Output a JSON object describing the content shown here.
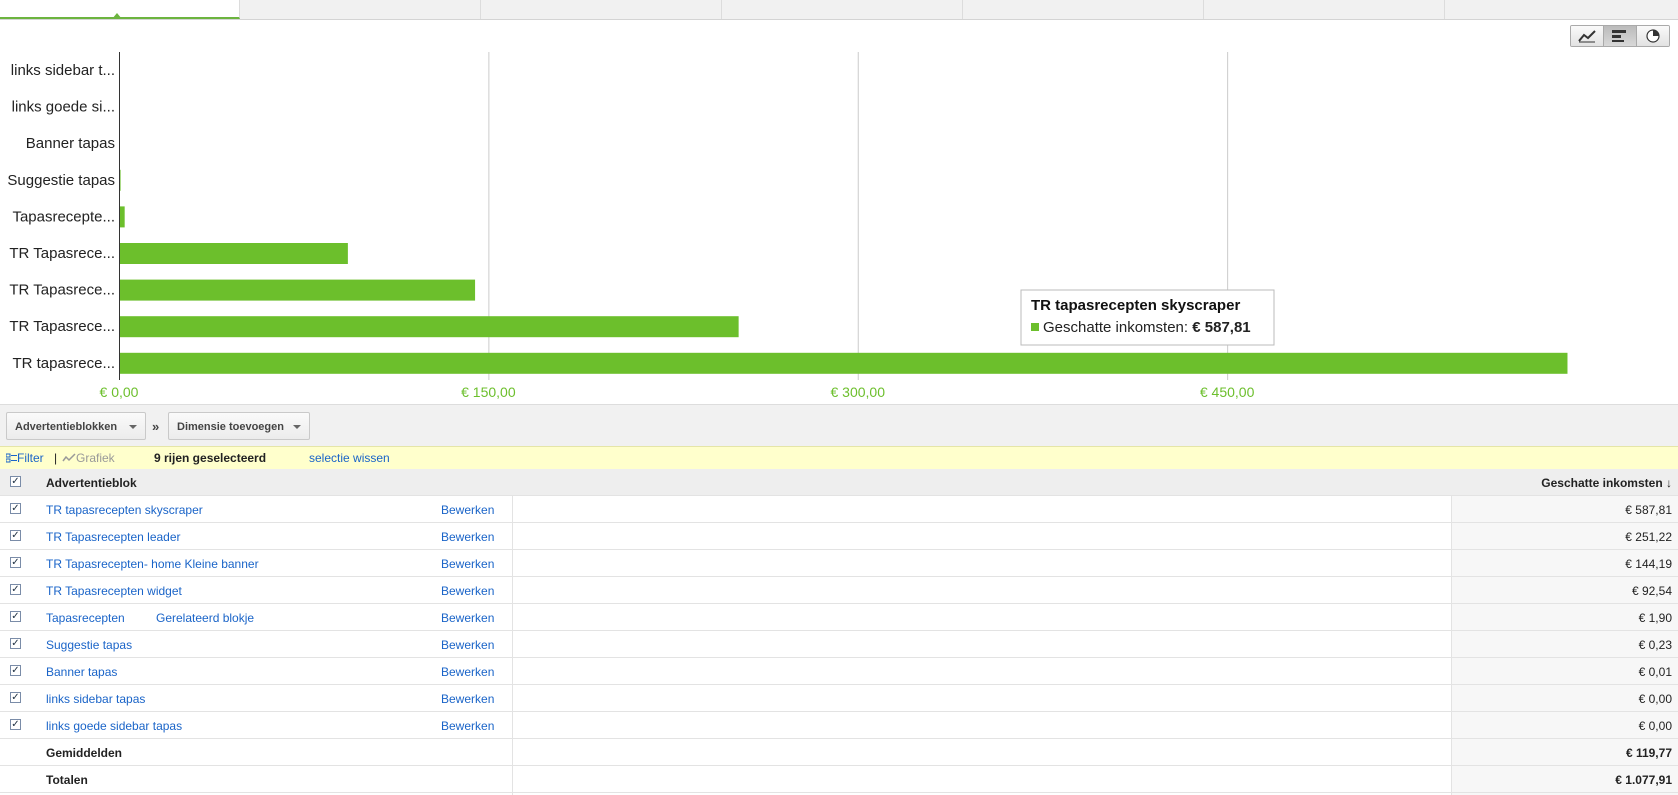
{
  "chart_data": {
    "type": "bar",
    "orientation": "horizontal",
    "categories": [
      "links sidebar t...",
      "links goede si...",
      "Banner tapas",
      "Suggestie tapas",
      "Tapasrecepte...",
      "TR Tapasrece...",
      "TR Tapasrece...",
      "TR Tapasrece...",
      "TR tapasrece..."
    ],
    "values": [
      0.0,
      0.0,
      0.01,
      0.23,
      1.9,
      92.54,
      144.19,
      251.22,
      587.81
    ],
    "xlim": [
      0,
      600
    ],
    "xticks": [
      "€ 0,00",
      "€ 150,00",
      "€ 300,00",
      "€ 450,00"
    ],
    "xtick_values": [
      0,
      150,
      300,
      450
    ],
    "bar_color": "#6cbf2c",
    "grid": true,
    "tooltip": {
      "title": "TR tapasrecepten skyscraper",
      "label": "Geschatte inkomsten:",
      "value": "€ 587,81"
    }
  },
  "toolbar": {
    "primary_dimension": "Advertentieblokken",
    "separator": "»",
    "add_dimension": "Dimensie toevoegen"
  },
  "selection": {
    "filter": "Filter",
    "divider": "|",
    "graph": "Grafiek",
    "count": "9 rijen geselecteerd",
    "clear": "selectie wissen"
  },
  "table": {
    "col_name": "Advertentieblok",
    "col_value": "Geschatte inkomsten ↓",
    "edit_label": "Bewerken",
    "rows": [
      {
        "name": "TR tapasrecepten skyscraper",
        "extra": "",
        "value": "€ 587,81"
      },
      {
        "name": "TR Tapasrecepten leader",
        "extra": "",
        "value": "€ 251,22"
      },
      {
        "name": "TR Tapasrecepten- home Kleine banner",
        "extra": "",
        "value": "€ 144,19"
      },
      {
        "name": "TR Tapasrecepten widget",
        "extra": "",
        "value": "€ 92,54"
      },
      {
        "name": "Tapasrecepten",
        "extra": "Gerelateerd blokje",
        "value": "€ 1,90"
      },
      {
        "name": "Suggestie tapas",
        "extra": "",
        "value": "€ 0,23"
      },
      {
        "name": "Banner tapas",
        "extra": "",
        "value": "€ 0,01"
      },
      {
        "name": "links sidebar tapas",
        "extra": "",
        "value": "€ 0,00"
      },
      {
        "name": "links goede sidebar tapas",
        "extra": "",
        "value": "€ 0,00"
      }
    ],
    "avg_label": "Gemiddelden",
    "avg_value": "€ 119,77",
    "total_label": "Totalen",
    "total_value": "€ 1.077,91"
  },
  "icons": {
    "line_chart": "line-chart-icon",
    "bar_chart": "bar-chart-icon",
    "pie_chart": "pie-chart-icon"
  }
}
